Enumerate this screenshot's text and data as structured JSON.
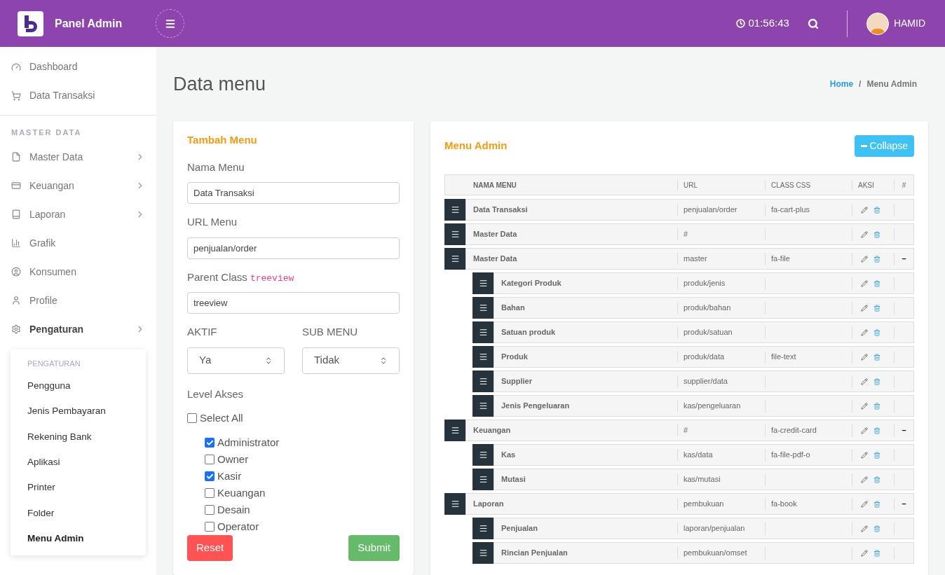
{
  "header": {
    "brand": "Panel Admin",
    "clock": "01:56:43",
    "user": "HAMID"
  },
  "sidebar": {
    "items": [
      {
        "label": "Dashboard",
        "has_submenu": false,
        "selected": false
      },
      {
        "label": "Data Transaksi",
        "has_submenu": false,
        "selected": false
      }
    ],
    "section": "MASTER DATA",
    "section_items": [
      {
        "label": "Master Data",
        "has_submenu": true,
        "selected": false
      },
      {
        "label": "Keuangan",
        "has_submenu": true,
        "selected": false
      },
      {
        "label": "Laporan",
        "has_submenu": true,
        "selected": false
      },
      {
        "label": "Grafik",
        "has_submenu": false,
        "selected": false
      },
      {
        "label": "Konsumen",
        "has_submenu": false,
        "selected": false
      },
      {
        "label": "Profile",
        "has_submenu": false,
        "selected": false
      },
      {
        "label": "Pengaturan",
        "has_submenu": true,
        "selected": true
      }
    ],
    "submenu": {
      "title": "PENGATURAN",
      "items": [
        {
          "label": "Pengguna",
          "selected": false
        },
        {
          "label": "Jenis Pembayaran",
          "selected": false
        },
        {
          "label": "Rekening Bank",
          "selected": false
        },
        {
          "label": "Aplikasi",
          "selected": false
        },
        {
          "label": "Printer",
          "selected": false
        },
        {
          "label": "Folder",
          "selected": false
        },
        {
          "label": "Menu Admin",
          "selected": true
        }
      ]
    }
  },
  "page": {
    "title": "Data menu",
    "breadcrumb": [
      "Home",
      "/",
      "Menu Admin"
    ]
  },
  "form": {
    "title": "Tambah Menu",
    "fields": [
      {
        "label": "Nama Menu",
        "value": "Data Transaksi"
      },
      {
        "label": "URL Menu",
        "value": "penjualan/order"
      },
      {
        "label": "Parent Class",
        "code": "treeview",
        "value": "treeview"
      }
    ],
    "selects": [
      {
        "label": "AKTIF",
        "value": "Ya"
      },
      {
        "label": "SUB MENU",
        "value": "Tidak"
      }
    ],
    "level_label": "Level Akses",
    "select_all": {
      "label": "Select All",
      "checked": false
    },
    "levels": [
      {
        "label": "Administrator",
        "checked": true
      },
      {
        "label": "Owner",
        "checked": false
      },
      {
        "label": "Kasir",
        "checked": true
      },
      {
        "label": "Keuangan",
        "checked": false
      },
      {
        "label": "Desain",
        "checked": false
      },
      {
        "label": "Operator",
        "checked": false
      }
    ],
    "buttons": {
      "reset": "Reset",
      "submit": "Submit"
    }
  },
  "menu_tree": {
    "title": "Menu Admin",
    "collapse_button": "Collapse",
    "columns": [
      "NAMA MENU",
      "URL",
      "CLASS CSS",
      "AKSI",
      "#"
    ],
    "rows": [
      {
        "name": "Data Transaksi",
        "url": "penjualan/order",
        "css": "fa-cart-plus"
      },
      {
        "name": "Master Data",
        "url": "#"
      },
      {
        "name": "Master Data",
        "url": "master",
        "css": "fa-file",
        "toggle": "–",
        "children": [
          {
            "name": "Kategori Produk",
            "url": "produk/jenis"
          },
          {
            "name": "Bahan",
            "url": "produk/bahan"
          },
          {
            "name": "Satuan produk",
            "url": "produk/satuan"
          },
          {
            "name": "Produk",
            "url": "produk/data",
            "css": "file-text"
          },
          {
            "name": "Supplier",
            "url": "supplier/data"
          },
          {
            "name": "Jenis Pengeluaran",
            "url": "kas/pengeluaran"
          }
        ]
      },
      {
        "name": "Keuangan",
        "url": "#",
        "css": "fa-credit-card",
        "toggle": "–",
        "children": [
          {
            "name": "Kas",
            "url": "kas/data",
            "css": "fa-file-pdf-o"
          },
          {
            "name": "Mutasi",
            "url": "kas/mutasi"
          }
        ]
      },
      {
        "name": "Laporan",
        "url": "pembukuan",
        "css": "fa-book",
        "toggle": "–",
        "children": [
          {
            "name": "Penjualan",
            "url": "laporan/penjualan"
          },
          {
            "name": "Rincian Penjualan",
            "url": "pembukuan/omset"
          }
        ]
      }
    ]
  }
}
